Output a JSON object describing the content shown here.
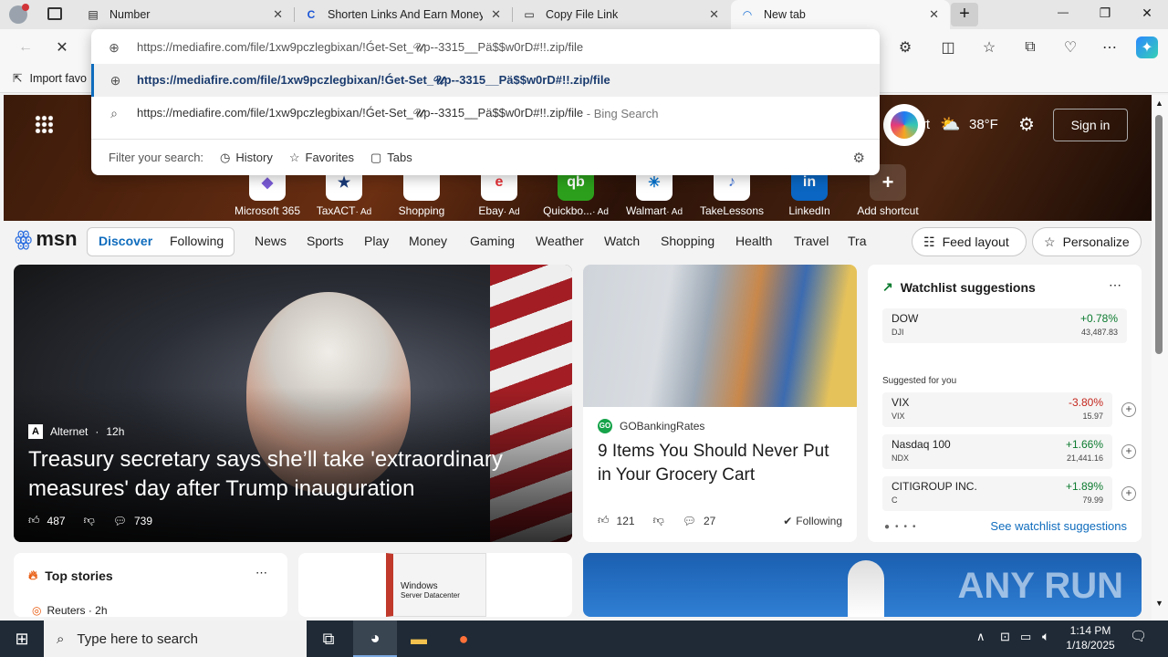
{
  "tabs": [
    {
      "title": "Number",
      "icon": "notepad-icon"
    },
    {
      "title": "Shorten Links And Earn Money | S",
      "icon": "shortener-icon"
    },
    {
      "title": "Copy File Link",
      "icon": "page-icon"
    },
    {
      "title": "New tab",
      "icon": "loading-icon"
    }
  ],
  "window": {
    "minimize": "—",
    "restore": "❐",
    "close": "✕",
    "new_tab": "+"
  },
  "favorites_bar": {
    "import": "Import favo"
  },
  "omnibox": {
    "input": "https://mediafire.com/file/1xw9pczlegbixan/!Ǵet-Set_𝓤p--3315__Pä$$w0rD#!!.zip/file",
    "suggestion": "https://mediafire.com/file/1xw9pczlegbixan/!Ǵet-Set_𝓤p--3315__Pä$$w0rD#!!.zip/file",
    "search_text": "https://mediafire.com/file/1xw9pczlegbixan/!Ǵet-Set_𝓤p--3315__Pä$$w0rD#!!.zip/file",
    "search_suffix": " - Bing Search",
    "filter_label": "Filter your search:",
    "filters": [
      "History",
      "Favorites",
      "Tabs"
    ]
  },
  "hero": {
    "partial": "nFort",
    "temp": "38°F",
    "signin": "Sign in"
  },
  "quicklinks": [
    {
      "label": "Microsoft 365",
      "ad": ""
    },
    {
      "label": "TaxACT",
      "ad": "· Ad"
    },
    {
      "label": "Shopping",
      "ad": ""
    },
    {
      "label": "Ebay",
      "ad": "· Ad"
    },
    {
      "label": "Quickbo...",
      "ad": "· Ad"
    },
    {
      "label": "Walmart",
      "ad": "· Ad"
    },
    {
      "label": "TakeLessons",
      "ad": ""
    },
    {
      "label": "LinkedIn",
      "ad": ""
    },
    {
      "label": "Add shortcut",
      "ad": ""
    }
  ],
  "msn": {
    "logo": "msn",
    "tabs": [
      "Discover",
      "Following"
    ],
    "nav": [
      "News",
      "Sports",
      "Play",
      "Money",
      "Gaming",
      "Weather",
      "Watch",
      "Shopping",
      "Health",
      "Travel",
      "Tra"
    ],
    "feed_layout": "Feed layout",
    "personalize": "Personalize"
  },
  "lead": {
    "source": "Alternet",
    "time": "12h",
    "source_mark": "A",
    "title": "Treasury secretary says she’ll take 'extraordinary measures' day after Trump inauguration",
    "likes": "487",
    "comments": "739"
  },
  "grocery": {
    "source": "GOBankingRates",
    "source_mark": "GO",
    "title": "9 Items You Should Never Put in Your Grocery Cart",
    "likes": "121",
    "comments": "27",
    "following": "Following"
  },
  "watchlist": {
    "title": "Watchlist suggestions",
    "main": {
      "name": "DOW",
      "sym": "DJI",
      "pct": "+0.78%",
      "val": "43,487.83"
    },
    "suggested_label": "Suggested for you",
    "items": [
      {
        "name": "VIX",
        "sym": "VIX",
        "pct": "-3.80%",
        "val": "15.97",
        "dir": "down"
      },
      {
        "name": "Nasdaq 100",
        "sym": "NDX",
        "pct": "+1.66%",
        "val": "21,441.16",
        "dir": "up"
      },
      {
        "name": "CITIGROUP INC.",
        "sym": "C",
        "pct": "+1.89%",
        "val": "79.99",
        "dir": "up"
      }
    ],
    "see_more": "See watchlist suggestions"
  },
  "top_stories": {
    "title": "Top stories",
    "source": "Reuters · 2h"
  },
  "windows_ad": {
    "line1": "Windows",
    "line2": "Server Datacenter"
  },
  "watermark": "ANY RUN",
  "taskbar": {
    "search_placeholder": "Type here to search",
    "time": "1:14 PM",
    "date": "1/18/2025"
  }
}
